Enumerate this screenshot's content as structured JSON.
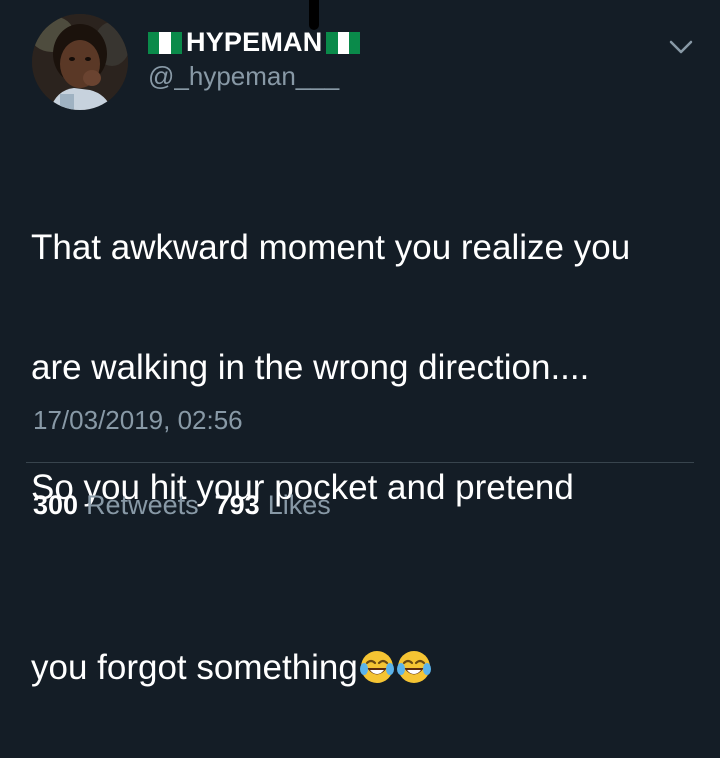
{
  "tweet": {
    "author": {
      "display_name": "HYPEMAN",
      "handle": "@_hypeman___",
      "avatar_icon": "child-photo-avatar",
      "flag_icon": "nigeria-flag-icon"
    },
    "menu_icon": "chevron-down-icon",
    "text_lines": [
      "That awkward moment you realize you",
      "are walking in the wrong direction....",
      "So you hit your pocket and pretend",
      "you forgot something"
    ],
    "emoji": [
      "face-with-tears-of-joy",
      "face-with-tears-of-joy"
    ],
    "timestamp": "17/03/2019, 02:56",
    "stats": {
      "retweets_count": "300",
      "retweets_label": "Retweets",
      "likes_count": "793",
      "likes_label": "Likes"
    }
  },
  "colors": {
    "background": "#141d26",
    "primary_text": "#ffffff",
    "secondary_text": "#8899a6",
    "divider": "#38444d"
  }
}
